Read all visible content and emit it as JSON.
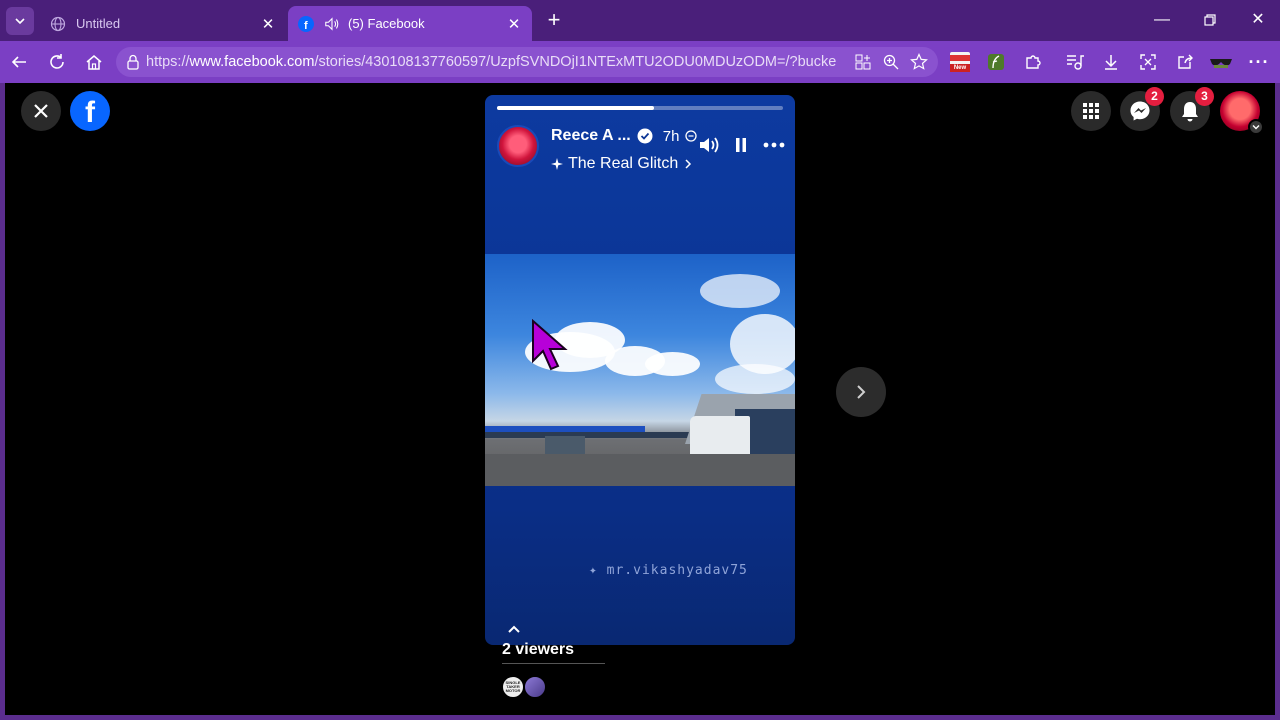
{
  "browser": {
    "tabs": [
      {
        "title": "Untitled",
        "active": false
      },
      {
        "title": "(5) Facebook",
        "active": true
      }
    ],
    "url": {
      "prefix": "https://",
      "host": "www.facebook.com",
      "path": "/stories/430108137760597/UzpfSVNDOjI1NTExMTU2ODU0MDUzODM=/?bucket..."
    },
    "extension_badge": "New"
  },
  "facebook": {
    "messenger_badge": "2",
    "notifications_badge": "3"
  },
  "story": {
    "author": "Reece A ...",
    "time": "7h",
    "subtitle": "The Real Glitch",
    "watermark": "mr.vikashyadav75",
    "progress": 0.55,
    "viewers_label": "2 viewers",
    "viewer_avatar_text": "SINGLE TAKER MOTOR"
  },
  "colors": {
    "frame": "#7b3fc4",
    "tabstrip": "#4a1f7a",
    "facebook_blue": "#0866ff",
    "badge_red": "#e41e3f",
    "story_bg": "#0b3595"
  }
}
